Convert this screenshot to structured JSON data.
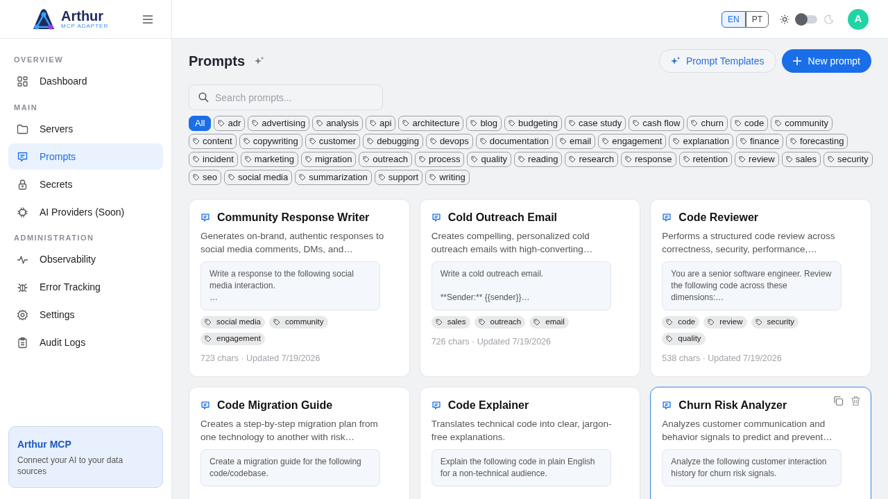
{
  "brand": {
    "name": "Arthur",
    "tagline": "MCP ADAPTER"
  },
  "header": {
    "languages": [
      {
        "label": "EN",
        "selected": true
      },
      {
        "label": "PT",
        "selected": false
      }
    ],
    "dark_mode": false,
    "avatar": "A"
  },
  "sidebar": {
    "sections": [
      {
        "title": "OVERVIEW",
        "items": [
          {
            "label": "Dashboard",
            "selected": false
          }
        ]
      },
      {
        "title": "MAIN",
        "items": [
          {
            "label": "Servers",
            "selected": false
          },
          {
            "label": "Prompts",
            "selected": true
          },
          {
            "label": "Secrets",
            "selected": false
          },
          {
            "label": "AI Providers (Soon)",
            "selected": false
          }
        ]
      },
      {
        "title": "ADMINISTRATION",
        "items": [
          {
            "label": "Observability",
            "selected": false
          },
          {
            "label": "Error Tracking",
            "selected": false
          },
          {
            "label": "Settings",
            "selected": false
          },
          {
            "label": "Audit Logs",
            "selected": false
          }
        ]
      }
    ],
    "promo": {
      "title": "Arthur MCP",
      "text": "Connect your AI to your data sources"
    }
  },
  "page": {
    "title": "Prompts",
    "templates_button": "Prompt Templates",
    "new_button": "New prompt",
    "search": {
      "placeholder": "Search prompts..."
    }
  },
  "filters": [
    {
      "label": "All",
      "selected": true,
      "kind": "all"
    },
    {
      "label": "adr",
      "selected": false,
      "kind": "tag"
    },
    {
      "label": "advertising",
      "selected": false,
      "kind": "tag"
    },
    {
      "label": "analysis",
      "selected": false,
      "kind": "tag"
    },
    {
      "label": "api",
      "selected": false,
      "kind": "tag"
    },
    {
      "label": "architecture",
      "selected": false,
      "kind": "tag"
    },
    {
      "label": "blog",
      "selected": false,
      "kind": "tag"
    },
    {
      "label": "budgeting",
      "selected": false,
      "kind": "tag"
    },
    {
      "label": "case study",
      "selected": false,
      "kind": "tag"
    },
    {
      "label": "cash flow",
      "selected": false,
      "kind": "tag"
    },
    {
      "label": "churn",
      "selected": false,
      "kind": "tag"
    },
    {
      "label": "code",
      "selected": false,
      "kind": "tag"
    },
    {
      "label": "community",
      "selected": false,
      "kind": "tag"
    },
    {
      "label": "content",
      "selected": false,
      "kind": "tag"
    },
    {
      "label": "copywriting",
      "selected": false,
      "kind": "tag"
    },
    {
      "label": "customer",
      "selected": false,
      "kind": "tag"
    },
    {
      "label": "debugging",
      "selected": false,
      "kind": "tag"
    },
    {
      "label": "devops",
      "selected": false,
      "kind": "tag"
    },
    {
      "label": "documentation",
      "selected": false,
      "kind": "tag"
    },
    {
      "label": "email",
      "selected": false,
      "kind": "tag"
    },
    {
      "label": "engagement",
      "selected": false,
      "kind": "tag"
    },
    {
      "label": "explanation",
      "selected": false,
      "kind": "tag"
    },
    {
      "label": "finance",
      "selected": false,
      "kind": "tag"
    },
    {
      "label": "forecasting",
      "selected": false,
      "kind": "tag"
    },
    {
      "label": "incident",
      "selected": false,
      "kind": "tag"
    },
    {
      "label": "marketing",
      "selected": false,
      "kind": "tag"
    },
    {
      "label": "migration",
      "selected": false,
      "kind": "tag"
    },
    {
      "label": "outreach",
      "selected": false,
      "kind": "tag"
    },
    {
      "label": "process",
      "selected": false,
      "kind": "tag"
    },
    {
      "label": "quality",
      "selected": false,
      "kind": "tag"
    },
    {
      "label": "reading",
      "selected": false,
      "kind": "tag"
    },
    {
      "label": "research",
      "selected": false,
      "kind": "tag"
    },
    {
      "label": "response",
      "selected": false,
      "kind": "tag"
    },
    {
      "label": "retention",
      "selected": false,
      "kind": "tag"
    },
    {
      "label": "review",
      "selected": false,
      "kind": "tag"
    },
    {
      "label": "sales",
      "selected": false,
      "kind": "tag"
    },
    {
      "label": "security",
      "selected": false,
      "kind": "tag"
    },
    {
      "label": "seo",
      "selected": false,
      "kind": "tag"
    },
    {
      "label": "social media",
      "selected": false,
      "kind": "tag"
    },
    {
      "label": "summarization",
      "selected": false,
      "kind": "tag"
    },
    {
      "label": "support",
      "selected": false,
      "kind": "tag"
    },
    {
      "label": "writing",
      "selected": false,
      "kind": "tag"
    }
  ],
  "prompts": [
    {
      "title": "Community Response Writer",
      "description": "Generates on-brand, authentic responses to social media comments, DMs, and…",
      "preview": "Write a response to the following social media interaction.\n…",
      "tags": [
        "social media",
        "community",
        "engagement"
      ],
      "meta": "723 chars · Updated 7/19/2026",
      "hovered": false
    },
    {
      "title": "Cold Outreach Email",
      "description": "Creates compelling, personalized cold outreach emails with high-converting…",
      "preview": "Write a cold outreach email.\n\n**Sender:** {{sender}}…",
      "tags": [
        "sales",
        "outreach",
        "email"
      ],
      "meta": "726 chars · Updated 7/19/2026",
      "hovered": false
    },
    {
      "title": "Code Reviewer",
      "description": "Performs a structured code review across correctness, security, performance,…",
      "preview": "You are a senior software engineer. Review the following code across these dimensions:…",
      "tags": [
        "code",
        "review",
        "security",
        "quality"
      ],
      "meta": "538 chars · Updated 7/19/2026",
      "hovered": false
    },
    {
      "title": "Code Migration Guide",
      "description": "Creates a step-by-step migration plan from one technology to another with risk…",
      "preview": "Create a migration guide for the following code/codebase.",
      "hovered": false
    },
    {
      "title": "Code Explainer",
      "description": "Translates technical code into clear, jargon-free explanations.",
      "preview": "Explain the following code in plain English for a non-technical audience.",
      "hovered": false
    },
    {
      "title": "Churn Risk Analyzer",
      "description": "Analyzes customer communication and behavior signals to predict and prevent…",
      "preview": "Analyze the following customer interaction history for churn risk signals.",
      "hovered": true
    }
  ]
}
